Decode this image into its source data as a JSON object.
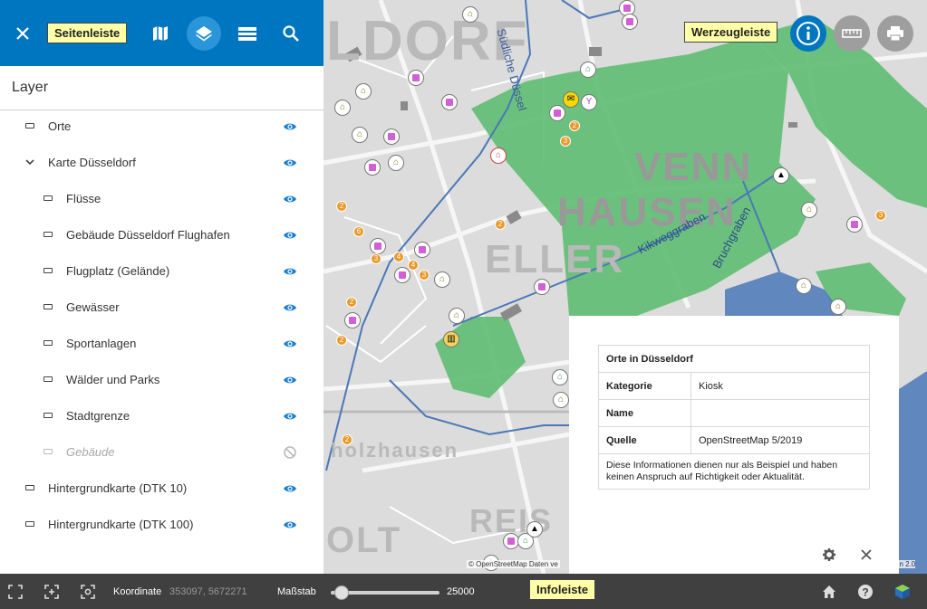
{
  "toolbar": {
    "sidebar_tooltip": "Seitenleiste",
    "tools_tooltip": "Werzeugleiste"
  },
  "sidebar": {
    "title": "Layer",
    "layers": [
      {
        "label": "Orte",
        "indent": 0,
        "expandable": false,
        "visible": true
      },
      {
        "label": "Karte Düsseldorf",
        "indent": 0,
        "expandable": true,
        "visible": true
      },
      {
        "label": "Flüsse",
        "indent": 1,
        "visible": true
      },
      {
        "label": "Gebäude Düsseldorf Flughafen",
        "indent": 1,
        "visible": true
      },
      {
        "label": "Flugplatz (Gelände)",
        "indent": 1,
        "visible": true
      },
      {
        "label": "Gewässer",
        "indent": 1,
        "visible": true
      },
      {
        "label": "Sportanlagen",
        "indent": 1,
        "visible": true
      },
      {
        "label": "Wälder und Parks",
        "indent": 1,
        "visible": true
      },
      {
        "label": "Stadtgrenze",
        "indent": 1,
        "visible": true
      },
      {
        "label": "Gebäude",
        "indent": 1,
        "visible": false
      },
      {
        "label": "Hintergrundkarte (DTK 10)",
        "indent": 0,
        "visible": true
      },
      {
        "label": "Hintergrundkarte (DTK 100)",
        "indent": 0,
        "visible": true
      }
    ]
  },
  "map": {
    "labels": [
      "LDORF",
      "VENN",
      "HAUSEN",
      "ELLER",
      "Südliche Düssel",
      "Kikweggraben",
      "Bruchgraben",
      "REIS",
      "OLT",
      "holzhausen"
    ],
    "attribution": "© OpenStreetMap Daten ve",
    "attribution_right": "on 2.0"
  },
  "info": {
    "title": "Orte in Düsseldorf",
    "rows": [
      {
        "key": "Kategorie",
        "value": "Kiosk"
      },
      {
        "key": "Name",
        "value": ""
      },
      {
        "key": "Quelle",
        "value": "OpenStreetMap 5/2019"
      }
    ],
    "note": "Diese Informationen dienen nur als Beispiel und haben keinen Anspruch auf Richtigkeit oder Aktualität."
  },
  "bottombar": {
    "coord_label": "Koordinate",
    "coord_value": "353097, 5672271",
    "scale_label": "Maßstab",
    "scale_value": "25000",
    "scale_fraction": 0.1,
    "infobar_tooltip": "Infoleiste"
  },
  "colors": {
    "primary": "#0076c0",
    "bar": "#404040",
    "tooltip": "#ffffa8",
    "eye": "#1a7fd0",
    "park": "#5fbd72",
    "river": "#4a78b8"
  }
}
